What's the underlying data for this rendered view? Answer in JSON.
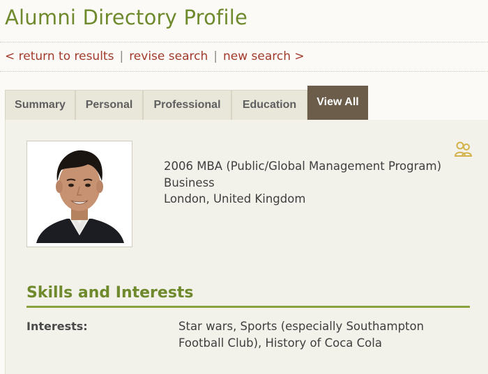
{
  "page": {
    "title": "Alumni Directory Profile"
  },
  "nav": {
    "return": "< return to results",
    "sep1": "|",
    "revise": "revise search",
    "sep2": "|",
    "new": "new search >"
  },
  "tabs": [
    {
      "label": "Summary",
      "active": false
    },
    {
      "label": "Personal",
      "active": false
    },
    {
      "label": "Professional",
      "active": false
    },
    {
      "label": "Education",
      "active": false
    },
    {
      "label": "View All",
      "active": true
    }
  ],
  "profile": {
    "photo_icon": "profile-photo",
    "group_icon": "group-icon",
    "lines": [
      "2006 MBA (Public/Global Management Program)",
      "Business",
      "London, United Kingdom"
    ]
  },
  "skills": {
    "heading": "Skills and Interests",
    "interests_label": "Interests:",
    "interests_value": "Star wars, Sports (especially Southampton Football Club), History of Coca Cola"
  },
  "colors": {
    "accent_green": "#6f8a2c",
    "link_red": "#a23a2c",
    "active_tab": "#6b5d49",
    "tab_bg": "#e9e7da",
    "panel_bg": "#f2f1ea"
  }
}
